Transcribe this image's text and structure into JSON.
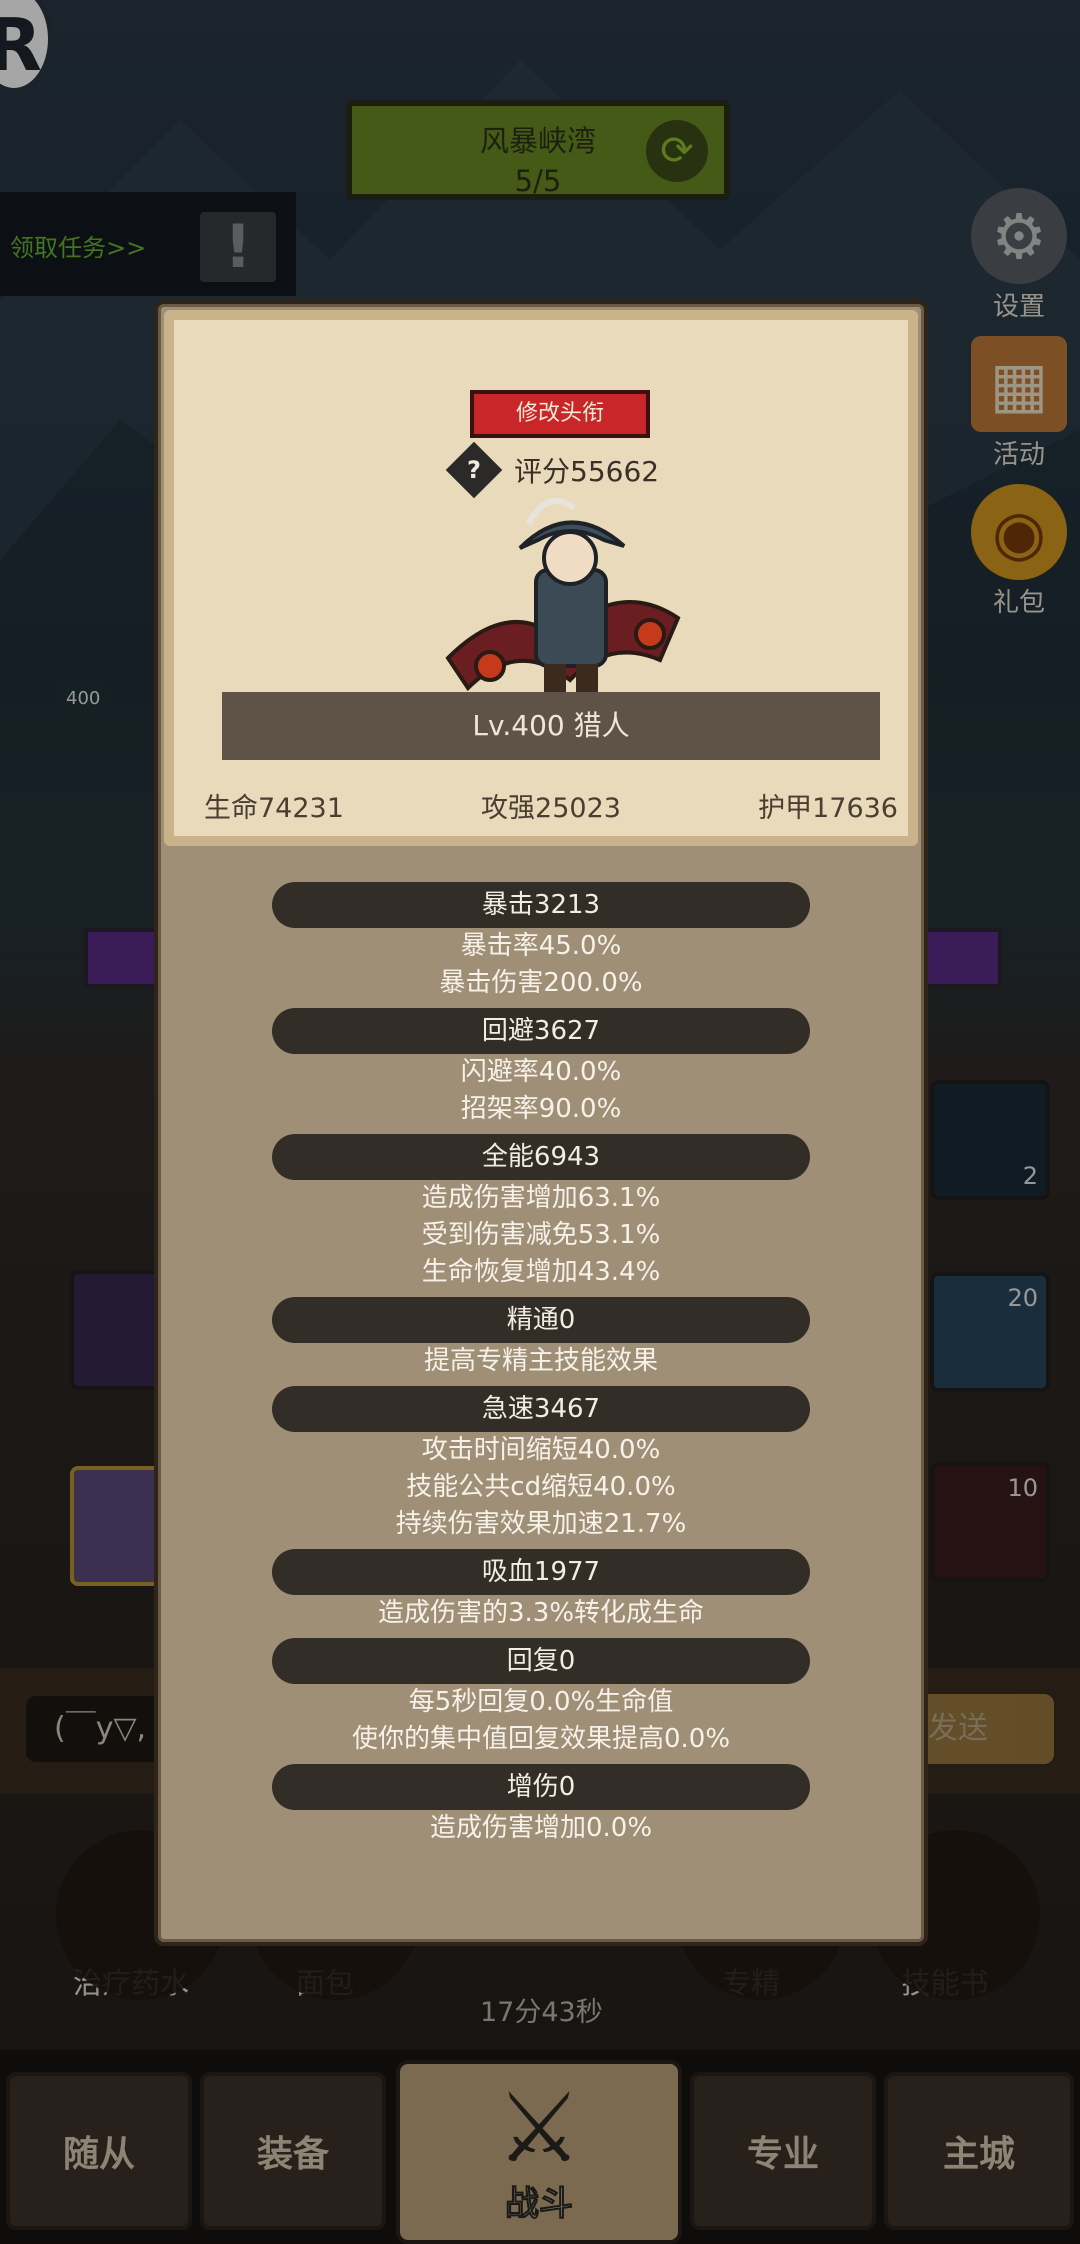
{
  "background": {
    "area_name": "风暴峡湾",
    "area_progress": "5/5",
    "quest_text": "领取任务>>",
    "side_buttons": [
      {
        "label": "设置",
        "icon": "gear-icon"
      },
      {
        "label": "活动",
        "icon": "event-icon"
      },
      {
        "label": "礼包",
        "icon": "gift-icon"
      }
    ],
    "level_chip": "400",
    "chat_input": "(￣y▽,",
    "send_label": "发送",
    "slot_counts": [
      "2",
      "20",
      "10"
    ],
    "quick_items": [
      "治疗药水",
      "面包",
      "专精",
      "技能书"
    ],
    "timer": "17分43秒",
    "nav": {
      "followers": "随从",
      "equipment": "装备",
      "battle": "战斗",
      "profession": "专业",
      "main_city": "主城"
    }
  },
  "panel": {
    "rename_label": "修改头衔",
    "score": "评分55662",
    "name_line": "Lv.400 猎人",
    "base_stats": [
      "生命74231",
      "攻强25023",
      "护甲17636"
    ],
    "stat_groups": [
      {
        "header": "暴击3213",
        "lines": [
          "暴击率45.0%",
          "暴击伤害200.0%"
        ]
      },
      {
        "header": "回避3627",
        "lines": [
          "闪避率40.0%",
          "招架率90.0%"
        ]
      },
      {
        "header": "全能6943",
        "lines": [
          "造成伤害增加63.1%",
          "受到伤害减免53.1%",
          "生命恢复增加43.4%"
        ]
      },
      {
        "header": "精通0",
        "lines": [
          "提高专精主技能效果"
        ]
      },
      {
        "header": "急速3467",
        "lines": [
          "攻击时间缩短40.0%",
          "技能公共cd缩短40.0%",
          "持续伤害效果加速21.7%"
        ]
      },
      {
        "header": "吸血1977",
        "lines": [
          "造成伤害的3.3%转化成生命"
        ]
      },
      {
        "header": "回复0",
        "lines": [
          "每5秒回复0.0%生命值",
          "使你的集中值回复效果提高0.0%"
        ]
      },
      {
        "header": "增伤0",
        "lines": [
          "造成伤害增加0.0%"
        ]
      }
    ]
  },
  "colors": {
    "panel_bg": "#a08f77",
    "panel_top_bg": "#e8dabb",
    "rename_red": "#c9262a",
    "header_dark": "#332d27"
  }
}
